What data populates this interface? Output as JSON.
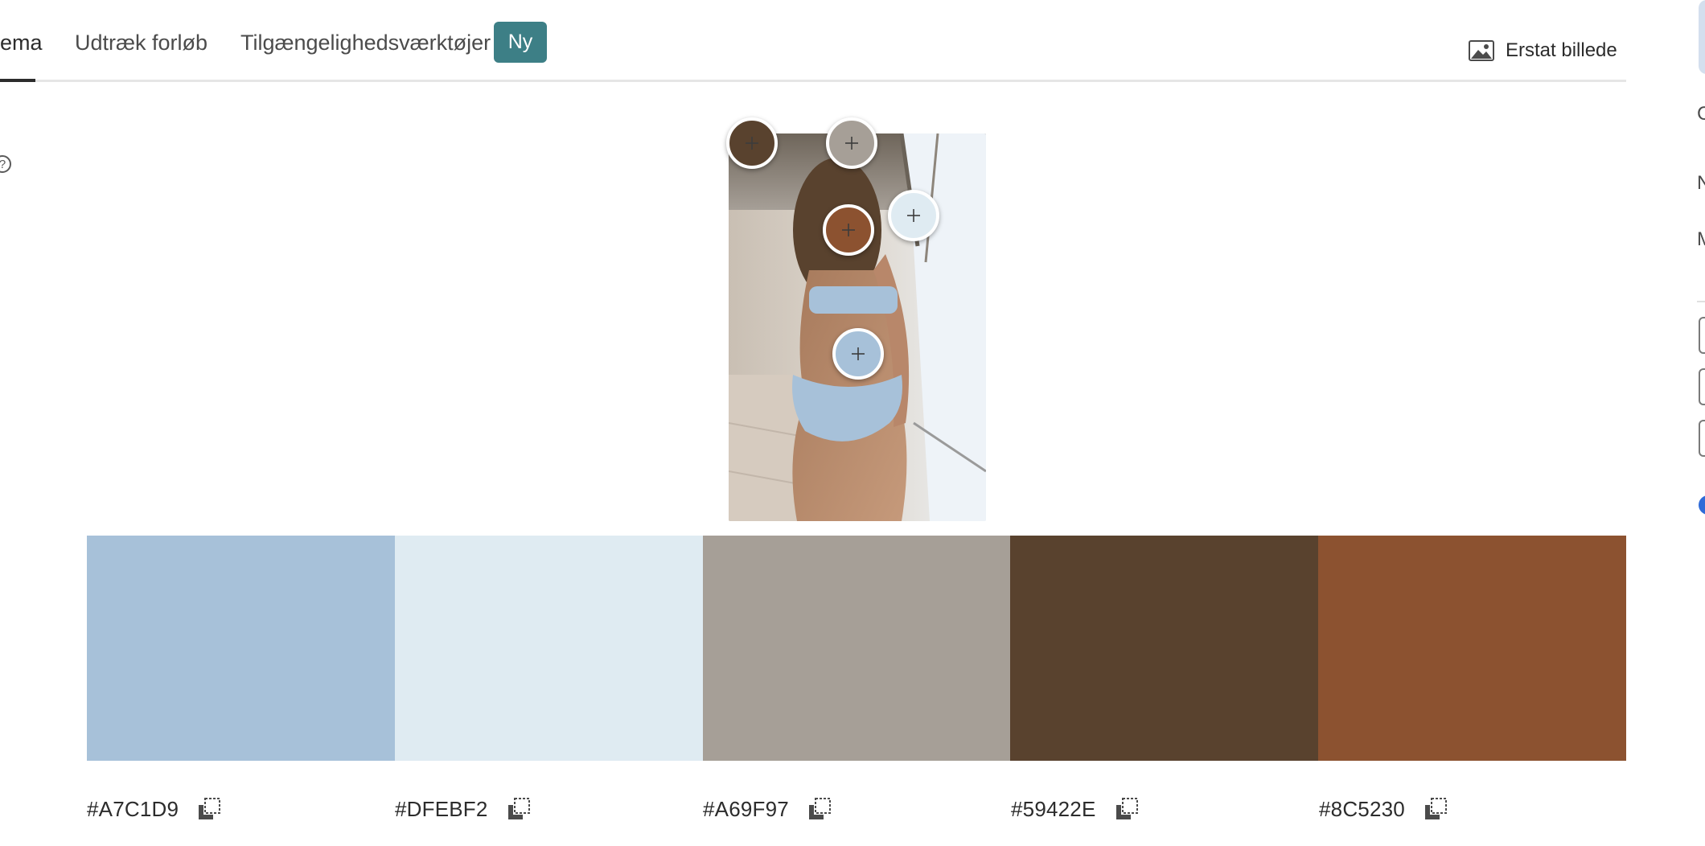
{
  "tabs": [
    {
      "label": "ema",
      "active": true
    },
    {
      "label": "Udtræk forløb",
      "active": false
    },
    {
      "label": "Tilgængelighedsværktøjer",
      "active": false
    }
  ],
  "badge": {
    "label": "Ny",
    "color": "#3D7F86"
  },
  "replace_image": {
    "label": "Erstat billede",
    "icon": "image-icon"
  },
  "help": {
    "icon": "question-circle-icon",
    "glyph": "?"
  },
  "photo": {
    "description_icon": "photo-image"
  },
  "pickers": [
    {
      "name": "picker-1",
      "color": "#59422E"
    },
    {
      "name": "picker-2",
      "color": "#A69F97"
    },
    {
      "name": "picker-3",
      "color": "#8C5230"
    },
    {
      "name": "picker-4",
      "color": "#DFEBF2"
    },
    {
      "name": "picker-5",
      "color": "#A7C1D9"
    }
  ],
  "swatches": [
    {
      "hex": "#A7C1D9"
    },
    {
      "hex": "#DFEBF2"
    },
    {
      "hex": "#A69F97"
    },
    {
      "hex": "#59422E"
    },
    {
      "hex": "#8C5230"
    }
  ],
  "right_panel": {
    "letters": [
      "C",
      "N",
      "M"
    ],
    "toggle_color": "#2F6BD8"
  }
}
